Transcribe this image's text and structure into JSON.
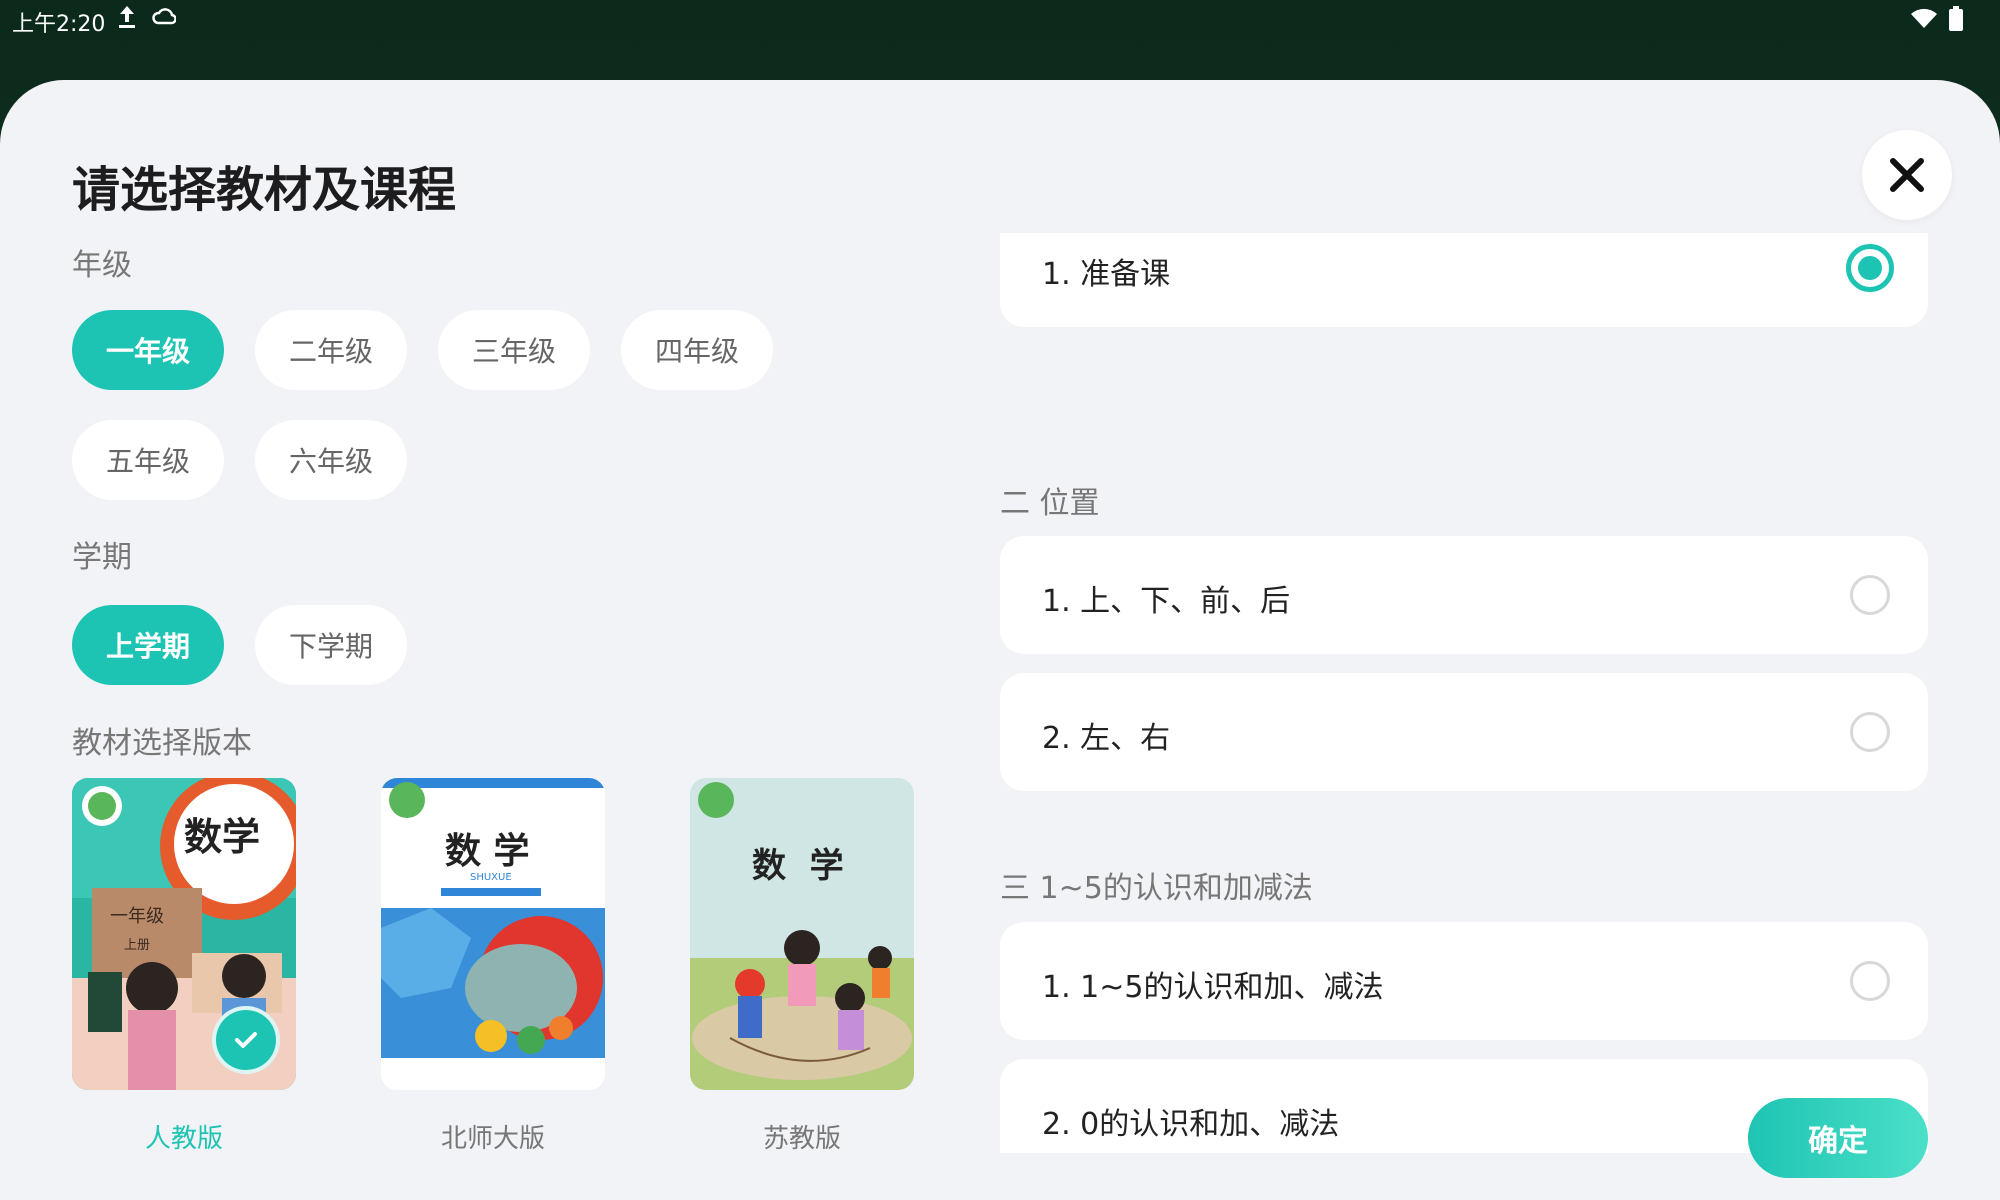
{
  "status_bar": {
    "time": "上午2:20"
  },
  "title": "请选择教材及课程",
  "grade": {
    "label": "年级",
    "options": [
      "一年级",
      "二年级",
      "三年级",
      "四年级",
      "五年级",
      "六年级"
    ],
    "selected": "一年级"
  },
  "semester": {
    "label": "学期",
    "options": [
      "上学期",
      "下学期"
    ],
    "selected": "上学期"
  },
  "textbook": {
    "label": "教材选择版本",
    "options": [
      {
        "name": "人教版",
        "cover_title": "数学",
        "grade_text": "一年级",
        "volume_text": "上册",
        "selected": true
      },
      {
        "name": "北师大版",
        "cover_title": "数 学",
        "subtitle": "SHUXUE",
        "selected": false
      },
      {
        "name": "苏教版",
        "cover_title": "数  学",
        "selected": false
      }
    ]
  },
  "lessons": {
    "first_item": {
      "label": "1. 准备课",
      "checked": true
    },
    "units": [
      {
        "title": "二 位置",
        "items": [
          {
            "label": "1. 上、下、前、后",
            "checked": false
          },
          {
            "label": "2. 左、右",
            "checked": false
          }
        ]
      },
      {
        "title": "三 1~5的认识和加减法",
        "items": [
          {
            "label": "1. 1~5的认识和加、减法",
            "checked": false
          },
          {
            "label": "2. 0的认识和加、减法",
            "checked": false
          }
        ]
      }
    ]
  },
  "confirm_label": "确定",
  "colors": {
    "accent": "#1ec4b3",
    "background": "#f2f3f6",
    "card": "#ffffff"
  }
}
